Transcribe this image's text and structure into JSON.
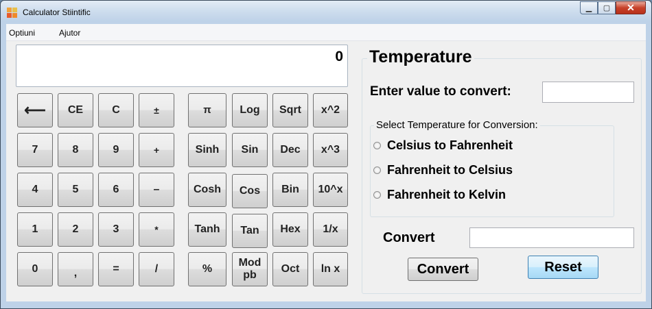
{
  "window": {
    "title": "Calculator Stiintific"
  },
  "menu": {
    "options": "Optiuni",
    "help": "Ajutor"
  },
  "display": {
    "value": "0"
  },
  "keypad": {
    "backspace": "⟵",
    "ce": "CE",
    "c": "C",
    "plus_minus": "±",
    "seven": "7",
    "eight": "8",
    "nine": "9",
    "add": "+",
    "four": "4",
    "five": "5",
    "six": "6",
    "subtract": "–",
    "one": "1",
    "two": "2",
    "three": "3",
    "multiply": "*",
    "zero": "0",
    "comma": ",",
    "equals": "=",
    "divide": "/"
  },
  "scientific": {
    "pi": "π",
    "log": "Log",
    "sqrt": "Sqrt",
    "x_squared": "x^2",
    "sinh": "Sinh",
    "sin": "Sin",
    "dec": "Dec",
    "x_cubed": "x^3",
    "cosh": "Cosh",
    "cos": "Cos",
    "bin": "Bin",
    "ten_pow_x": "10^x",
    "tanh": "Tanh",
    "tan": "Tan",
    "hex": "Hex",
    "reciprocal": "1/x",
    "percent": "%",
    "mod_line1": "Mod",
    "mod_line2": "pb",
    "oct": "Oct",
    "ln": "ln x"
  },
  "temperature": {
    "group_title": "Temperature",
    "enter_label": "Enter value to convert:",
    "enter_value": "",
    "select_title": "Select Temperature for Conversion:",
    "options": [
      "Celsius to Fahrenheit",
      "Fahrenheit to Celsius",
      "Fahrenheit to Kelvin"
    ],
    "result_label": "Convert",
    "result_value": "",
    "convert_button": "Convert",
    "reset_button": "Reset"
  },
  "colors": {
    "accent_focus": "#3c7fb1",
    "titlebar_close": "#c7412a"
  }
}
